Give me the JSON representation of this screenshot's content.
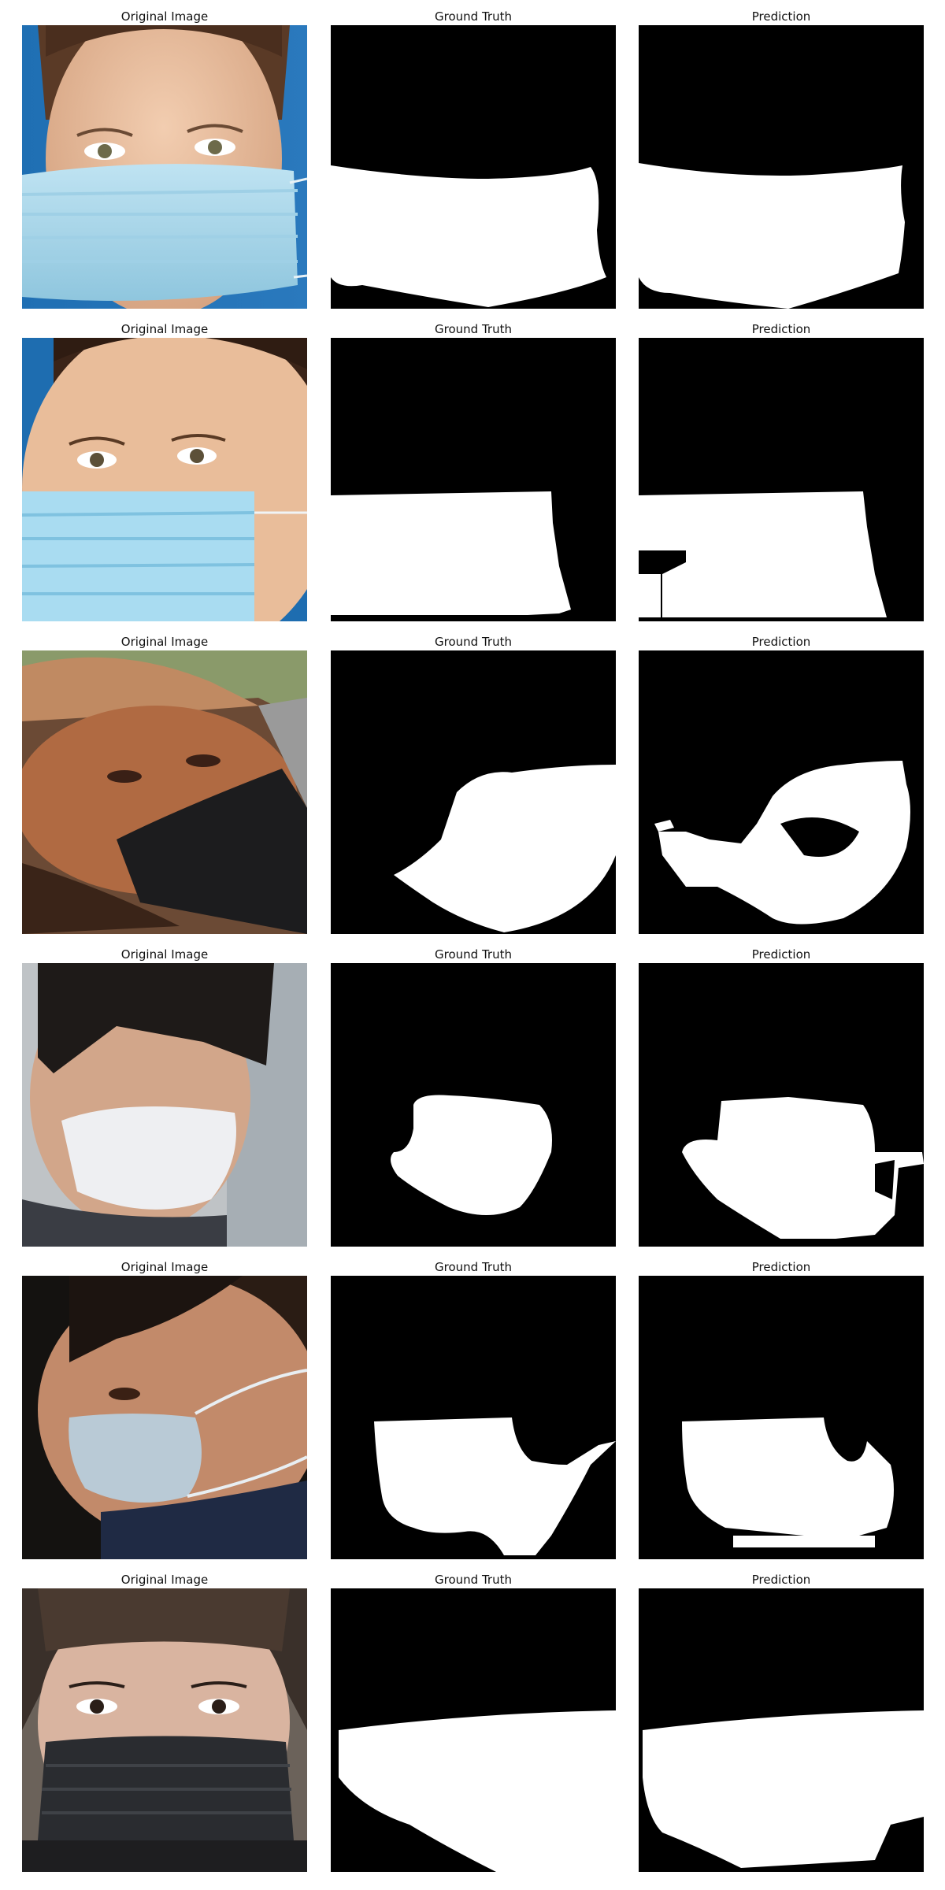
{
  "figure": {
    "column_titles": [
      "Original Image",
      "Ground Truth",
      "Prediction"
    ],
    "rows": [
      {
        "original": {
          "titles": "Original Image",
          "description_tag": "woman-blue-surgical-mask"
        },
        "ground_truth": {
          "title": "Ground Truth"
        },
        "prediction": {
          "title": "Prediction"
        }
      },
      {
        "original": {
          "titles": "Original Image",
          "description_tag": "woman-blue-mask-closeup"
        },
        "ground_truth": {
          "title": "Ground Truth"
        },
        "prediction": {
          "title": "Prediction"
        }
      },
      {
        "original": {
          "titles": "Original Image",
          "description_tag": "man-cap-black-mask"
        },
        "ground_truth": {
          "title": "Ground Truth"
        },
        "prediction": {
          "title": "Prediction"
        }
      },
      {
        "original": {
          "titles": "Original Image",
          "description_tag": "blurred-woman-white-mask"
        },
        "ground_truth": {
          "title": "Ground Truth"
        },
        "prediction": {
          "title": "Prediction"
        }
      },
      {
        "original": {
          "titles": "Original Image",
          "description_tag": "woman-profile-white-mask"
        },
        "ground_truth": {
          "title": "Ground Truth"
        },
        "prediction": {
          "title": "Prediction"
        }
      },
      {
        "original": {
          "titles": "Original Image",
          "description_tag": "woman-black-mask-bangs"
        },
        "ground_truth": {
          "title": "Ground Truth"
        },
        "prediction": {
          "title": "Prediction"
        }
      }
    ]
  },
  "colors": {
    "mask_background": "#000000",
    "mask_foreground": "#ffffff",
    "title_text": "#111111"
  }
}
